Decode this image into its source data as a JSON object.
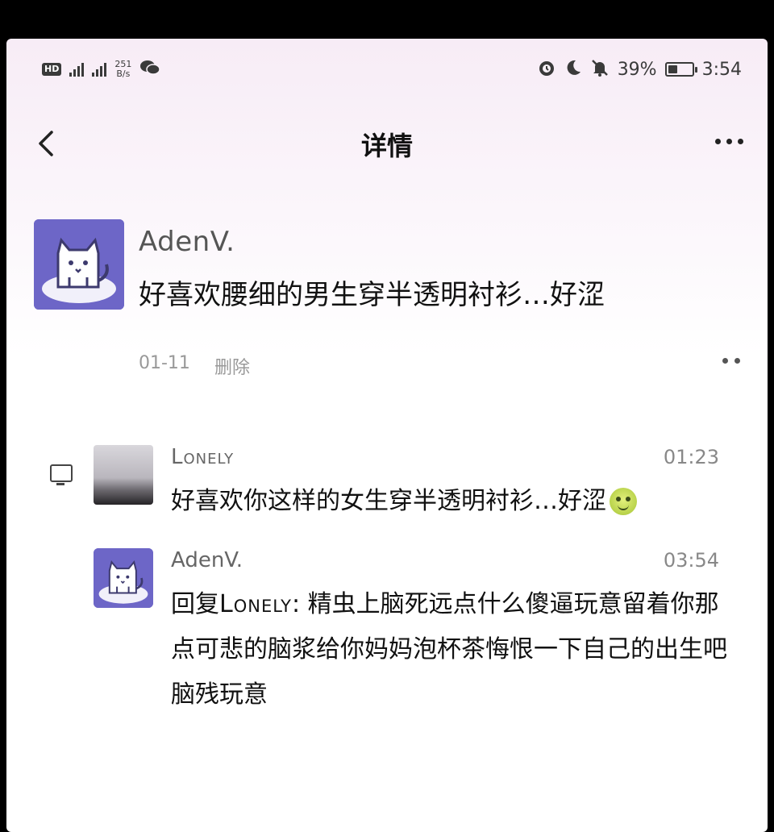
{
  "status_bar": {
    "hd_label": "HD",
    "net_speed_value": "251",
    "net_speed_unit": "B/s",
    "battery_percent": "39%",
    "battery_level": 0.39,
    "time": "3:54",
    "icons": [
      "hd-icon",
      "signal-4g-icon",
      "signal-icon",
      "wechat-icon",
      "alarm-icon",
      "moon-icon",
      "mute-bell-icon",
      "battery-icon"
    ]
  },
  "header": {
    "title": "详情",
    "back_icon": "chevron-left-icon",
    "more_icon": "more-dots-icon"
  },
  "post": {
    "author": "AdenV.",
    "content": "好喜欢腰细的男生穿半透明衬衫…好涩",
    "time": "01-11",
    "delete_label": "删除"
  },
  "comments": [
    {
      "author": "Lonely",
      "time": "01:23",
      "text": "好喜欢你这样的女生穿半透明衬衫…好涩",
      "emoji": "sweat-grin-emoji"
    },
    {
      "author": "AdenV.",
      "time": "03:54",
      "reply_prefix": "回复",
      "reply_to": "Lonely",
      "text": ": 精虫上脑死远点什么傻逼玩意留着你那点可悲的脑浆给你妈妈泡杯茶悔恨一下自己的出生吧脑残玩意"
    }
  ],
  "colors": {
    "avatar_bg": "#6d66c7",
    "header_tint": "#f7ecf6"
  }
}
